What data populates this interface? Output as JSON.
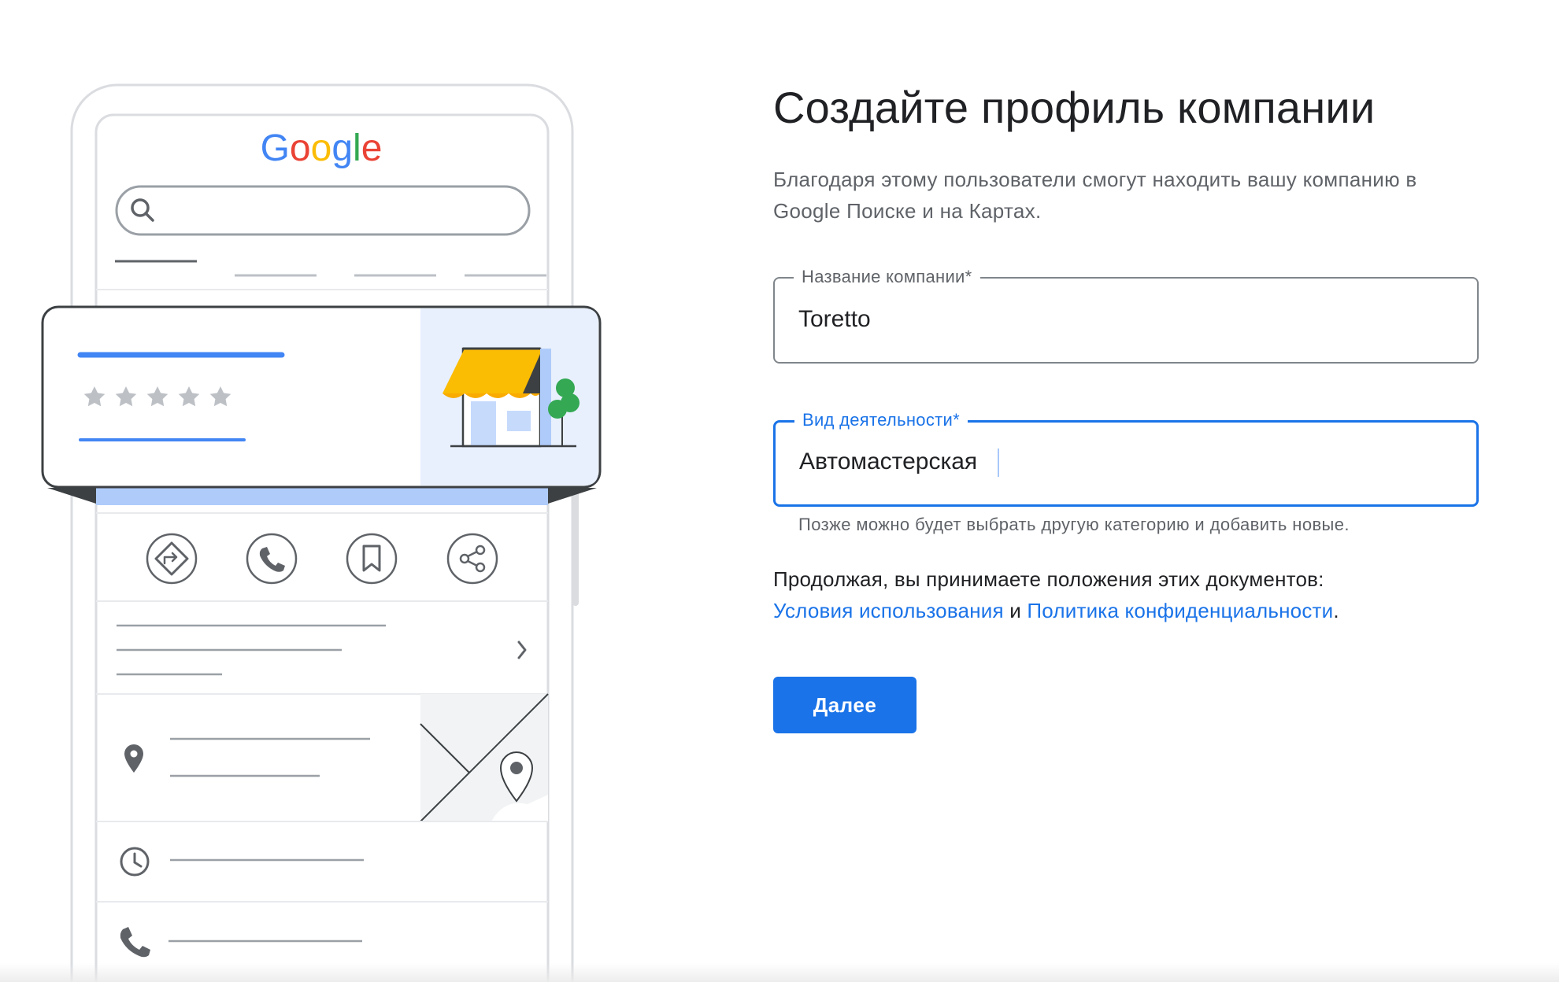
{
  "illustration": {
    "logo_text": "Google",
    "logo_colors": [
      "#4285F4",
      "#EA4335",
      "#FBBC05",
      "#4285F4",
      "#34A853",
      "#EA4335"
    ],
    "accent_color": "#4285F4",
    "awning_color": "#FBBC04",
    "tree_color": "#34A853",
    "star_count": 5
  },
  "form": {
    "title": "Создайте профиль компании",
    "subtitle": "Благодаря этому пользователи смогут находить вашу компанию в Google Поиске и на Картах.",
    "company_name": {
      "label": "Название компании*",
      "value": "Toretto"
    },
    "category": {
      "label": "Вид деятельности*",
      "value": "Автомастерская",
      "helper": "Позже можно будет выбрать другую категорию и добавить новые."
    },
    "terms": {
      "prefix": "Продолжая, вы принимаете положения этих документов:",
      "link_terms": "Условия использования",
      "conjunction": "и",
      "link_privacy": "Политика конфиденциальности",
      "suffix": "."
    },
    "next_label": "Далее",
    "primary_color": "#1a73e8"
  }
}
